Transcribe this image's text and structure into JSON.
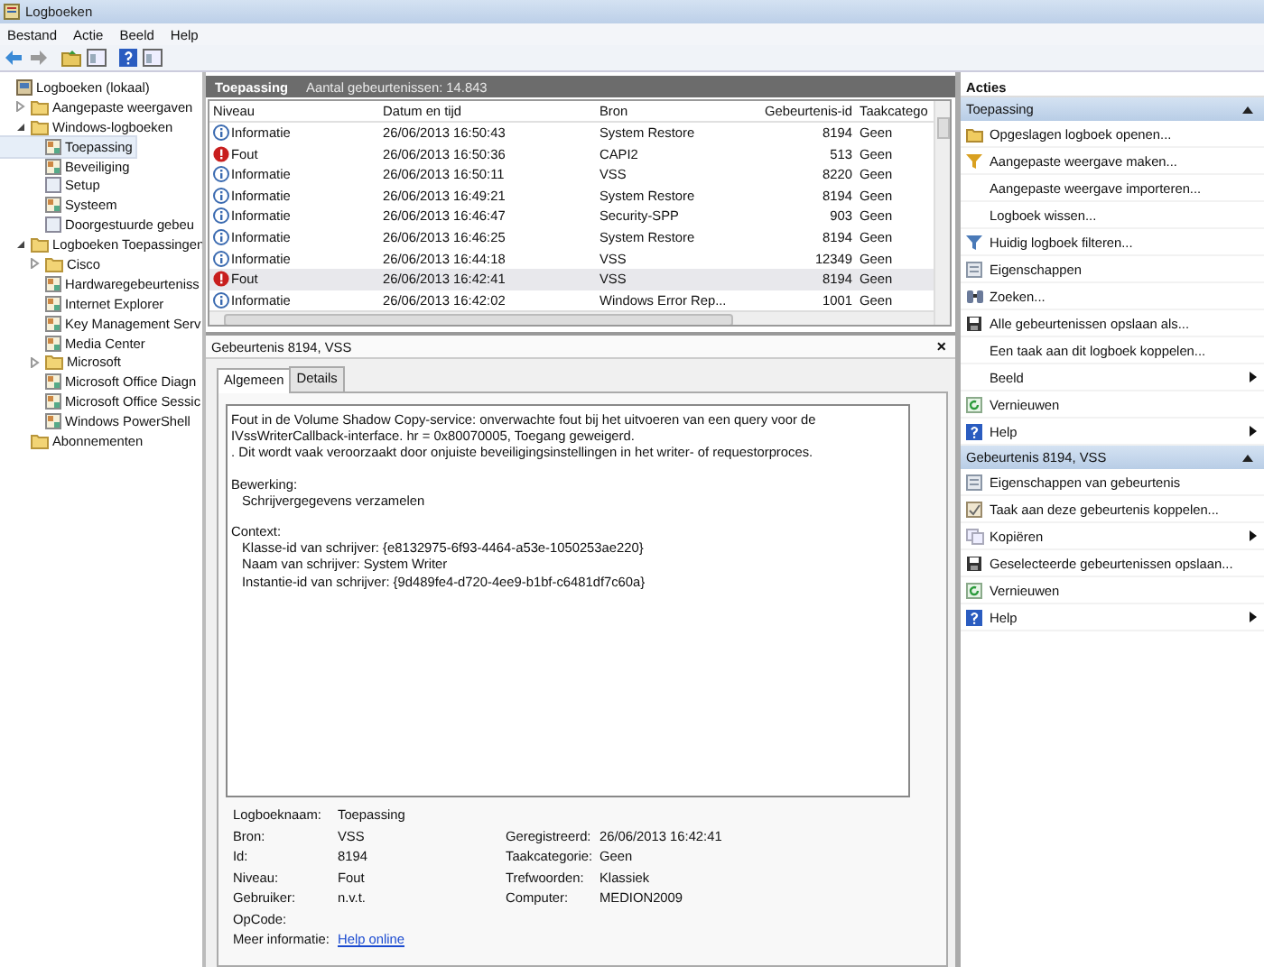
{
  "window": {
    "title": "Logboeken"
  },
  "menu": [
    "Bestand",
    "Actie",
    "Beeld",
    "Help"
  ],
  "toolbar": [
    {
      "kind": "back"
    },
    {
      "kind": "forward"
    },
    {
      "kind": "up"
    },
    {
      "kind": "panel"
    },
    {
      "kind": "help"
    },
    {
      "kind": "panel"
    }
  ],
  "tree": [
    {
      "label": "Logboeken (lokaal)",
      "kind": "computer",
      "selected": false,
      "children": [
        {
          "label": "Aangepaste weergaven",
          "kind": "folder",
          "selected": false,
          "expanded": false
        },
        {
          "label": "Windows-logboeken",
          "kind": "folder",
          "selected": false,
          "expanded": true,
          "children": [
            {
              "label": "Toepassing",
              "kind": "log",
              "selected": true
            },
            {
              "label": "Beveiliging",
              "kind": "log",
              "selected": false
            },
            {
              "label": "Setup",
              "kind": "blank",
              "selected": false
            },
            {
              "label": "Systeem",
              "kind": "log",
              "selected": false
            },
            {
              "label": "Doorgestuurde gebeu",
              "kind": "blank",
              "selected": false
            }
          ]
        },
        {
          "label": "Logboeken Toepassingen",
          "kind": "folder",
          "selected": false,
          "expanded": true,
          "children": [
            {
              "label": "Cisco",
              "kind": "folder",
              "selected": false,
              "expanded": false
            },
            {
              "label": "Hardwaregebeurteniss",
              "kind": "log",
              "selected": false
            },
            {
              "label": "Internet Explorer",
              "kind": "log",
              "selected": false
            },
            {
              "label": "Key Management Serv",
              "kind": "log",
              "selected": false
            },
            {
              "label": "Media Center",
              "kind": "log",
              "selected": false
            },
            {
              "label": "Microsoft",
              "kind": "folder",
              "selected": false,
              "expanded": false
            },
            {
              "label": "Microsoft Office Diagn",
              "kind": "log",
              "selected": false
            },
            {
              "label": "Microsoft Office Sessic",
              "kind": "log",
              "selected": false
            },
            {
              "label": "Windows PowerShell",
              "kind": "log",
              "selected": false
            }
          ]
        },
        {
          "label": "Abonnementen",
          "kind": "folder",
          "selected": false
        }
      ]
    }
  ],
  "list_header": {
    "title": "Toepassing",
    "count": "Aantal gebeurtenissen: 14.843"
  },
  "table": {
    "columns": [
      "Niveau",
      "Datum en tijd",
      "Bron",
      "Gebeurtenis-id",
      "Taakcatego"
    ],
    "rows": [
      {
        "kind": "info",
        "cells": [
          "Informatie",
          "26/06/2013 16:50:43",
          "System Restore",
          "8194",
          "Geen"
        ],
        "selected": false
      },
      {
        "kind": "error",
        "cells": [
          "Fout",
          "26/06/2013 16:50:36",
          "CAPI2",
          "513",
          "Geen"
        ],
        "selected": false
      },
      {
        "kind": "info",
        "cells": [
          "Informatie",
          "26/06/2013 16:50:11",
          "VSS",
          "8220",
          "Geen"
        ],
        "selected": false
      },
      {
        "kind": "info",
        "cells": [
          "Informatie",
          "26/06/2013 16:49:21",
          "System Restore",
          "8194",
          "Geen"
        ],
        "selected": false
      },
      {
        "kind": "info",
        "cells": [
          "Informatie",
          "26/06/2013 16:46:47",
          "Security-SPP",
          "903",
          "Geen"
        ],
        "selected": false
      },
      {
        "kind": "info",
        "cells": [
          "Informatie",
          "26/06/2013 16:46:25",
          "System Restore",
          "8194",
          "Geen"
        ],
        "selected": false
      },
      {
        "kind": "info",
        "cells": [
          "Informatie",
          "26/06/2013 16:44:18",
          "VSS",
          "12349",
          "Geen"
        ],
        "selected": false
      },
      {
        "kind": "error",
        "cells": [
          "Fout",
          "26/06/2013 16:42:41",
          "VSS",
          "8194",
          "Geen"
        ],
        "selected": true
      },
      {
        "kind": "info",
        "cells": [
          "Informatie",
          "26/06/2013 16:42:02",
          "Windows Error Rep...",
          "1001",
          "Geen"
        ],
        "selected": false
      }
    ]
  },
  "detail": {
    "title": "Gebeurtenis 8194, VSS",
    "close": "×",
    "tabs": [
      {
        "label": "Algemeen",
        "selected": true
      },
      {
        "label": "Details",
        "selected": false
      }
    ],
    "description": [
      {
        "lines": [
          "Fout in de Volume Shadow Copy-service: onverwachte fout bij het uitvoeren van een query voor de",
          "IVssWriterCallback-interface. hr = 0x80070005, Toegang geweigerd.",
          ". Dit wordt vaak veroorzaakt door onjuiste beveiligingsinstellingen in het writer- of requestorproces."
        ]
      },
      {
        "heading": "Bewerking:",
        "lines": [
          "Schrijvergegevens verzamelen"
        ]
      },
      {
        "heading": "Context:",
        "lines": [
          "Klasse-id van schrijver: {e8132975-6f93-4464-a53e-1050253ae220}",
          "Naam van schrijver: System Writer",
          "Instantie-id van schrijver: {9d489fe4-d720-4ee9-b1bf-c6481df7c60a}"
        ]
      }
    ],
    "fields": [
      {
        "label": "Logboeknaam:",
        "value": "Toepassing"
      },
      {
        "label": "Bron:",
        "value": "VSS",
        "label2": "Geregistreerd:",
        "value2": "26/06/2013 16:42:41"
      },
      {
        "label": "Id:",
        "value": "8194",
        "label2": "Taakcategorie:",
        "value2": "Geen"
      },
      {
        "label": "Niveau:",
        "value": "Fout",
        "label2": "Trefwoorden:",
        "value2": "Klassiek"
      },
      {
        "label": "Gebruiker:",
        "value": "n.v.t.",
        "label2": "Computer:",
        "value2": "MEDION2009"
      },
      {
        "label": "OpCode:"
      }
    ],
    "more_info": {
      "label": "Meer informatie:",
      "link": "Help online"
    }
  },
  "actions": {
    "title": "Acties",
    "sections": [
      {
        "title": "Toepassing",
        "expanded": true,
        "items": [
          {
            "label": "Opgeslagen logboek openen...",
            "kind": "open",
            "submenu": false
          },
          {
            "label": "Aangepaste weergave maken...",
            "kind": "filter",
            "submenu": false
          },
          {
            "label": "Aangepaste weergave importeren...",
            "kind": "none",
            "submenu": false
          },
          {
            "label": "Logboek wissen...",
            "kind": "none",
            "submenu": false
          },
          {
            "label": "Huidig logboek filteren...",
            "kind": "filter2",
            "submenu": false
          },
          {
            "label": "Eigenschappen",
            "kind": "props",
            "submenu": false
          },
          {
            "label": "Zoeken...",
            "kind": "find",
            "submenu": false
          },
          {
            "label": "Alle gebeurtenissen opslaan als...",
            "kind": "save",
            "submenu": false
          },
          {
            "label": "Een taak aan dit logboek koppelen...",
            "kind": "none",
            "submenu": false
          },
          {
            "label": "Beeld",
            "kind": "none",
            "submenu": true
          },
          {
            "label": "Vernieuwen",
            "kind": "refresh",
            "submenu": false
          },
          {
            "label": "Help",
            "kind": "help",
            "submenu": true
          }
        ]
      },
      {
        "title": "Gebeurtenis 8194, VSS",
        "expanded": true,
        "items": [
          {
            "label": "Eigenschappen van gebeurtenis",
            "kind": "props",
            "submenu": false
          },
          {
            "label": "Taak aan deze gebeurtenis koppelen...",
            "kind": "task",
            "submenu": false
          },
          {
            "label": "Kopiëren",
            "kind": "copy",
            "submenu": true
          },
          {
            "label": "Geselecteerde gebeurtenissen opslaan...",
            "kind": "save",
            "submenu": false
          },
          {
            "label": "Vernieuwen",
            "kind": "refresh",
            "submenu": false
          },
          {
            "label": "Help",
            "kind": "help",
            "submenu": true
          }
        ]
      }
    ]
  }
}
